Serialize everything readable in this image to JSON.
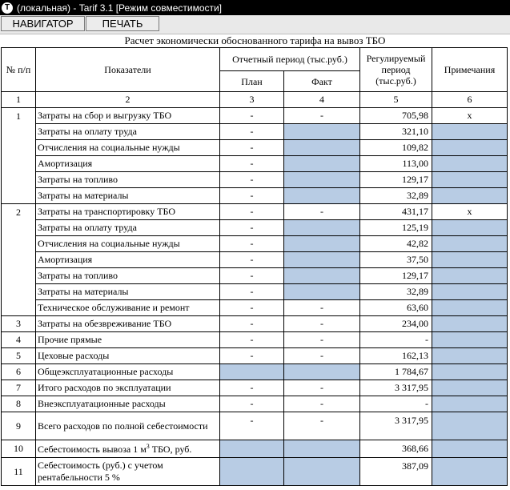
{
  "window": {
    "title": "(локальная) - Tarif 3.1  [Режим совместимости]"
  },
  "toolbar": {
    "navigator_label": "НАВИГАТОР",
    "print_label": "ПЕЧАТЬ"
  },
  "sheet": {
    "title": "Расчет экономически обоснованного тарифа на вывоз ТБО"
  },
  "headers": {
    "num": "№ п/п",
    "indicators": "Показатели",
    "report_period": "Отчетный период (тыс.руб.)",
    "plan": "План",
    "fact": "Факт",
    "regulated": "Регулируемый период (тыс.руб.)",
    "notes": "Примечания",
    "col_numbers": [
      "1",
      "2",
      "3",
      "4",
      "5",
      "6"
    ]
  },
  "rows": [
    {
      "num": "1",
      "name": "Затраты на сбор и выгрузку ТБО",
      "plan": "-",
      "fact": "-",
      "value": "705,98",
      "note": "х"
    },
    {
      "num": "",
      "name": "Затраты на оплату труда",
      "plan": "-",
      "fact": "",
      "value": "321,10",
      "note": ""
    },
    {
      "num": "",
      "name": "Отчисления на социальные нужды",
      "plan": "-",
      "fact": "",
      "value": "109,82",
      "note": ""
    },
    {
      "num": "",
      "name": "Амортизация",
      "plan": "-",
      "fact": "",
      "value": "113,00",
      "note": ""
    },
    {
      "num": "",
      "name": "Затраты на топливо",
      "plan": "-",
      "fact": "",
      "value": "129,17",
      "note": ""
    },
    {
      "num": "",
      "name": "Затраты на материалы",
      "plan": "-",
      "fact": "",
      "value": "32,89",
      "note": ""
    },
    {
      "num": "2",
      "name": "Затраты на транспортировку ТБО",
      "plan": "-",
      "fact": "-",
      "value": "431,17",
      "note": "х"
    },
    {
      "num": "",
      "name": "Затраты на оплату труда",
      "plan": "-",
      "fact": "",
      "value": "125,19",
      "note": ""
    },
    {
      "num": "",
      "name": "Отчисления на социальные нужды",
      "plan": "-",
      "fact": "",
      "value": "42,82",
      "note": ""
    },
    {
      "num": "",
      "name": "Амортизация",
      "plan": "-",
      "fact": "",
      "value": "37,50",
      "note": ""
    },
    {
      "num": "",
      "name": "Затраты на топливо",
      "plan": "-",
      "fact": "",
      "value": "129,17",
      "note": ""
    },
    {
      "num": "",
      "name": "Затраты на материалы",
      "plan": "-",
      "fact": "",
      "value": "32,89",
      "note": ""
    },
    {
      "num": "",
      "name": "Техническое обслуживание и ремонт",
      "plan": "-",
      "fact": "-",
      "value": "63,60",
      "note": ""
    },
    {
      "num": "3",
      "name": "Затраты на обезвреживание ТБО",
      "plan": "-",
      "fact": "-",
      "value": "234,00",
      "note": ""
    },
    {
      "num": "4",
      "name": "Прочие прямые",
      "plan": "-",
      "fact": "-",
      "value": "-",
      "note": ""
    },
    {
      "num": "5",
      "name": "Цеховые расходы",
      "plan": "-",
      "fact": "-",
      "value": "162,13",
      "note": ""
    },
    {
      "num": "6",
      "name": "Общеэксплуатационные расходы",
      "plan": "",
      "fact": "",
      "value": "1 784,67",
      "note": ""
    },
    {
      "num": "7",
      "name": "Итого расходов по эксплуатации",
      "plan": "-",
      "fact": "-",
      "value": "3 317,95",
      "note": ""
    },
    {
      "num": "8",
      "name": "Внеэксплуатационные расходы",
      "plan": "-",
      "fact": "-",
      "value": "-",
      "note": ""
    },
    {
      "num": "9",
      "name": "Всего расходов по полной себестоимости",
      "plan": "-",
      "fact": "-",
      "value": "3 317,95",
      "note": ""
    },
    {
      "num": "10",
      "name_main": "Себестоимость вывоза 1 м",
      "name_sup": "3",
      "name_tail": " ТБО, руб.",
      "plan": "",
      "fact": "",
      "value": "368,66",
      "note": ""
    },
    {
      "num": "11",
      "name": "Себестоимость (руб.) с учетом рентабельности 5 %",
      "plan": "",
      "fact": "",
      "value": "387,09",
      "note": ""
    }
  ],
  "colors": {
    "input_cell": "#b8cce4",
    "titlebar": "#000000"
  }
}
